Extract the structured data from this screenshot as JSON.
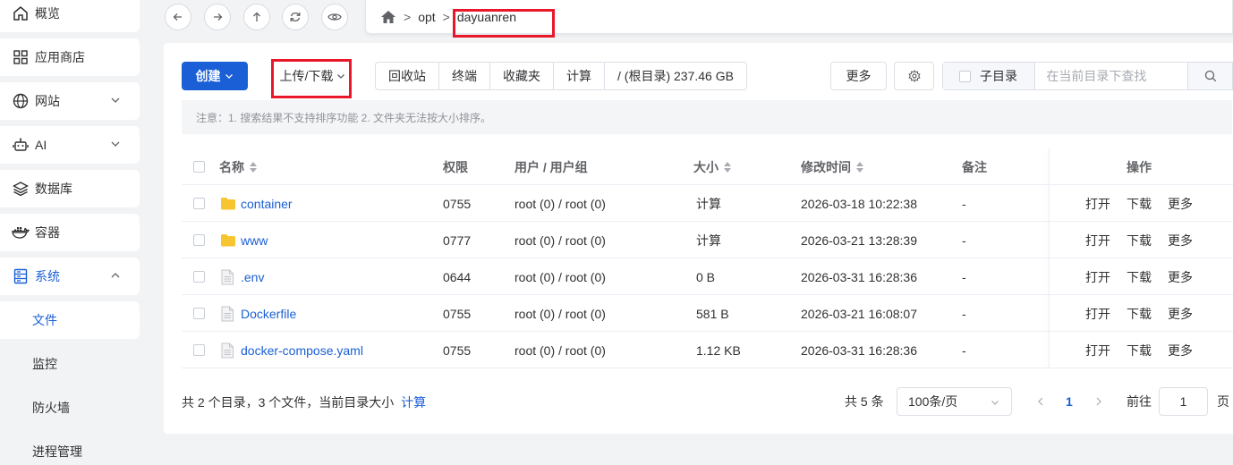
{
  "sidebar": {
    "items": [
      {
        "label": "概览",
        "icon": "home-icon"
      },
      {
        "label": "应用商店",
        "icon": "grid-icon"
      },
      {
        "label": "网站",
        "icon": "globe-icon"
      },
      {
        "label": "AI",
        "icon": "robot-icon"
      },
      {
        "label": "数据库",
        "icon": "layers-icon"
      },
      {
        "label": "容器",
        "icon": "docker-icon"
      },
      {
        "label": "系统",
        "icon": "server-icon"
      }
    ],
    "sub_items": [
      "文件",
      "监控",
      "防火墙",
      "进程管理"
    ],
    "active_sub": "文件"
  },
  "nav": {
    "path": [
      "opt",
      "dayuanren"
    ],
    "path_sep": ">"
  },
  "toolbar": {
    "create": "创建",
    "upload_download": "上传/下载",
    "group": [
      "回收站",
      "终端",
      "收藏夹",
      "计算",
      "/ (根目录) 237.46 GB"
    ],
    "more": "更多",
    "subdir": "子目录",
    "search_placeholder": "在当前目录下查找"
  },
  "notice": "注意：1. 搜索结果不支持排序功能 2. 文件夹无法按大小排序。",
  "table": {
    "headers": {
      "name": "名称",
      "perm": "权限",
      "user": "用户 / 用户组",
      "size": "大小",
      "mtime": "修改时间",
      "note": "备注",
      "ops": "操作"
    },
    "rows": [
      {
        "name": "container",
        "type": "folder",
        "perm": "0755",
        "user": "root (0) / root (0)",
        "size": "计算",
        "mtime": "2026-03-18 10:22:38",
        "note": "-",
        "ops": [
          "打开",
          "下载",
          "更多"
        ]
      },
      {
        "name": "www",
        "type": "folder",
        "perm": "0777",
        "user": "root (0) / root (0)",
        "size": "计算",
        "mtime": "2026-03-21 13:28:39",
        "note": "-",
        "ops": [
          "打开",
          "下载",
          "更多"
        ]
      },
      {
        "name": ".env",
        "type": "file",
        "perm": "0644",
        "user": "root (0) / root (0)",
        "size": "0 B",
        "mtime": "2026-03-31 16:28:36",
        "note": "-",
        "ops": [
          "打开",
          "下载",
          "更多"
        ]
      },
      {
        "name": "Dockerfile",
        "type": "file",
        "perm": "0755",
        "user": "root (0) / root (0)",
        "size": "581 B",
        "mtime": "2026-03-21 16:08:07",
        "note": "-",
        "ops": [
          "打开",
          "下载",
          "更多"
        ]
      },
      {
        "name": "docker-compose.yaml",
        "type": "file",
        "perm": "0755",
        "user": "root (0) / root (0)",
        "size": "1.12 KB",
        "mtime": "2026-03-31 16:28:36",
        "note": "-",
        "ops": [
          "打开",
          "下载",
          "更多"
        ]
      }
    ]
  },
  "footer": {
    "summary": "共 2 个目录，3 个文件，当前目录大小",
    "calc": "计算",
    "total": "共 5 条",
    "page_size": "100条/页",
    "current_page": "1",
    "goto": "前往",
    "goto_value": "1",
    "page_unit": "页"
  },
  "colors": {
    "accent": "#1a5fd6",
    "highlight": "#e8182a",
    "folder": "#f7c530"
  }
}
